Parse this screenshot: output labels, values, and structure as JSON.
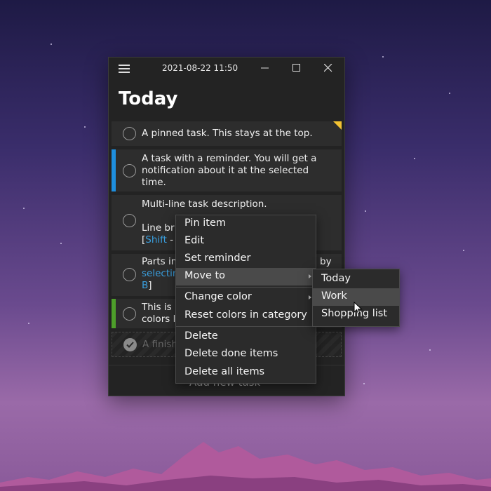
{
  "window": {
    "datetime": "2021-08-22 11:50",
    "list_title": "Today"
  },
  "tasks": [
    {
      "text": "A pinned task. This stays at the top.",
      "pinned": true
    },
    {
      "text": "A task with a reminder. You will get a\nnotification about it at the selected\ntime.",
      "color": "#1e8fde"
    },
    {
      "text_line1": "Multi-line task description.",
      "text_line3_start": "Line br",
      "bracket_open": "[",
      "shift": "Shift",
      "dash": " -"
    },
    {
      "text_start": "Parts in",
      "text_end": "by",
      "link1": "selectin",
      "link2": "B",
      "bracket_close": "]"
    },
    {
      "text": "This is\ncolors l",
      "color": "#4d9e2a"
    },
    {
      "text": "A finish",
      "done": true
    }
  ],
  "add_new": "Add new task",
  "context_menu": {
    "items": [
      "Pin item",
      "Edit",
      "Set reminder",
      "Move to",
      "Change color",
      "Reset colors in category",
      "Delete",
      "Delete done items",
      "Delete all items"
    ]
  },
  "submenu": {
    "items": [
      "Today",
      "Work",
      "Shopping list"
    ],
    "highlighted": "Work"
  },
  "icons": [
    "hamburger-menu-icon",
    "minimize-icon",
    "maximize-icon",
    "close-icon",
    "checkmark-icon",
    "pin-corner-icon",
    "submenu-arrow-icon",
    "mouse-cursor-icon"
  ],
  "colors": {
    "accent_blue": "#1e8fde",
    "accent_green": "#4d9e2a",
    "pin_yellow": "#f2c232",
    "link": "#3aa0e0"
  }
}
